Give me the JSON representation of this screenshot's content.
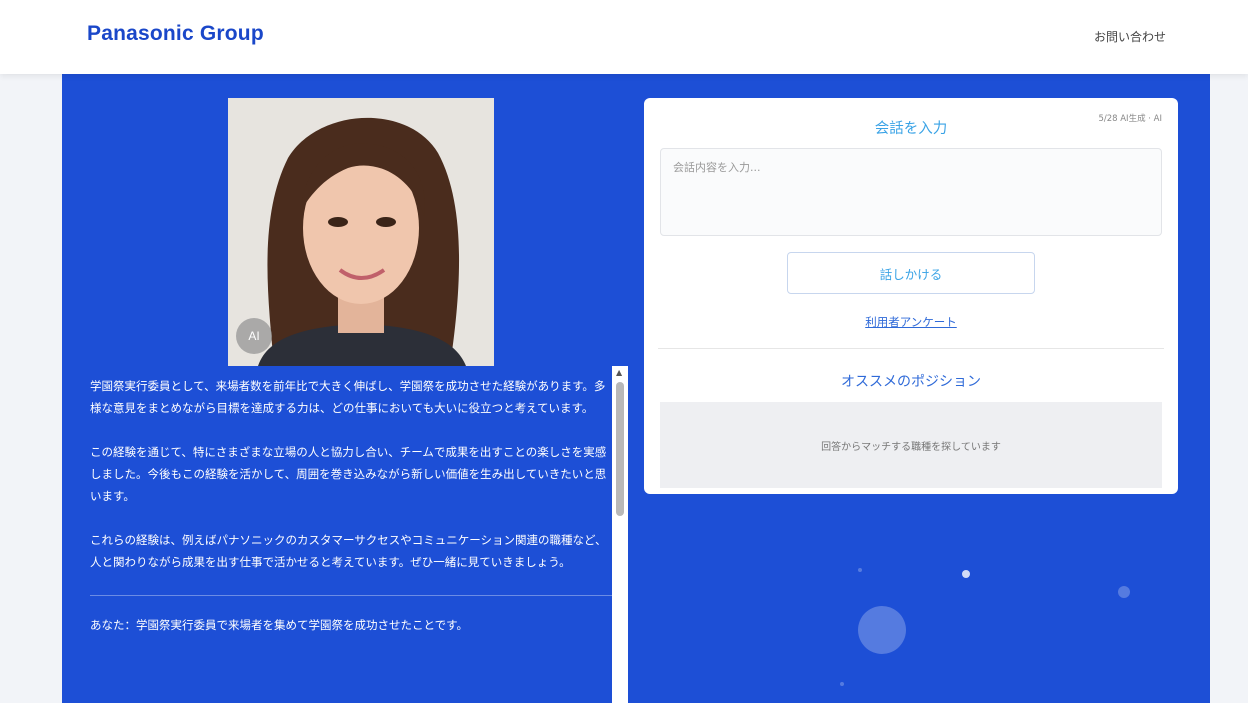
{
  "header": {
    "logo": "Panasonic Group",
    "contact_link": "お問い合わせ"
  },
  "portrait": {
    "badge": "AI"
  },
  "description": {
    "paragraphs": [
      "学園祭実行委員として、来場者数を前年比で大きく伸ばし、学園祭を成功させた経験があります。多様な意見をまとめながら目標を達成する力は、どの仕事においても大いに役立つと考えています。",
      "この経験を通じて、特にさまざまな立場の人と協力し合い、チームで成果を出すことの楽しさを実感しました。今後もこの経験を活かして、周囲を巻き込みながら新しい価値を生み出していきたいと思います。",
      "これらの経験は、例えばパナソニックのカスタマーサクセスやコミュニケーション関連の職種など、人と関わりながら成果を出す仕事で活かせると考えています。ぜひ一緒に見ていきましょう。"
    ],
    "footer": "あなた：学園祭実行委員で来場者を集めて学園祭を成功させたことです。"
  },
  "card": {
    "small_note": "5/28 AI生成 · AI",
    "title": "会話を入力",
    "textarea_placeholder": "会話内容を入力...",
    "submit_button": "話しかける",
    "link": "利用者アンケート",
    "section_title": "オススメのポジション",
    "gray_message": "回答からマッチする職種を探しています"
  }
}
